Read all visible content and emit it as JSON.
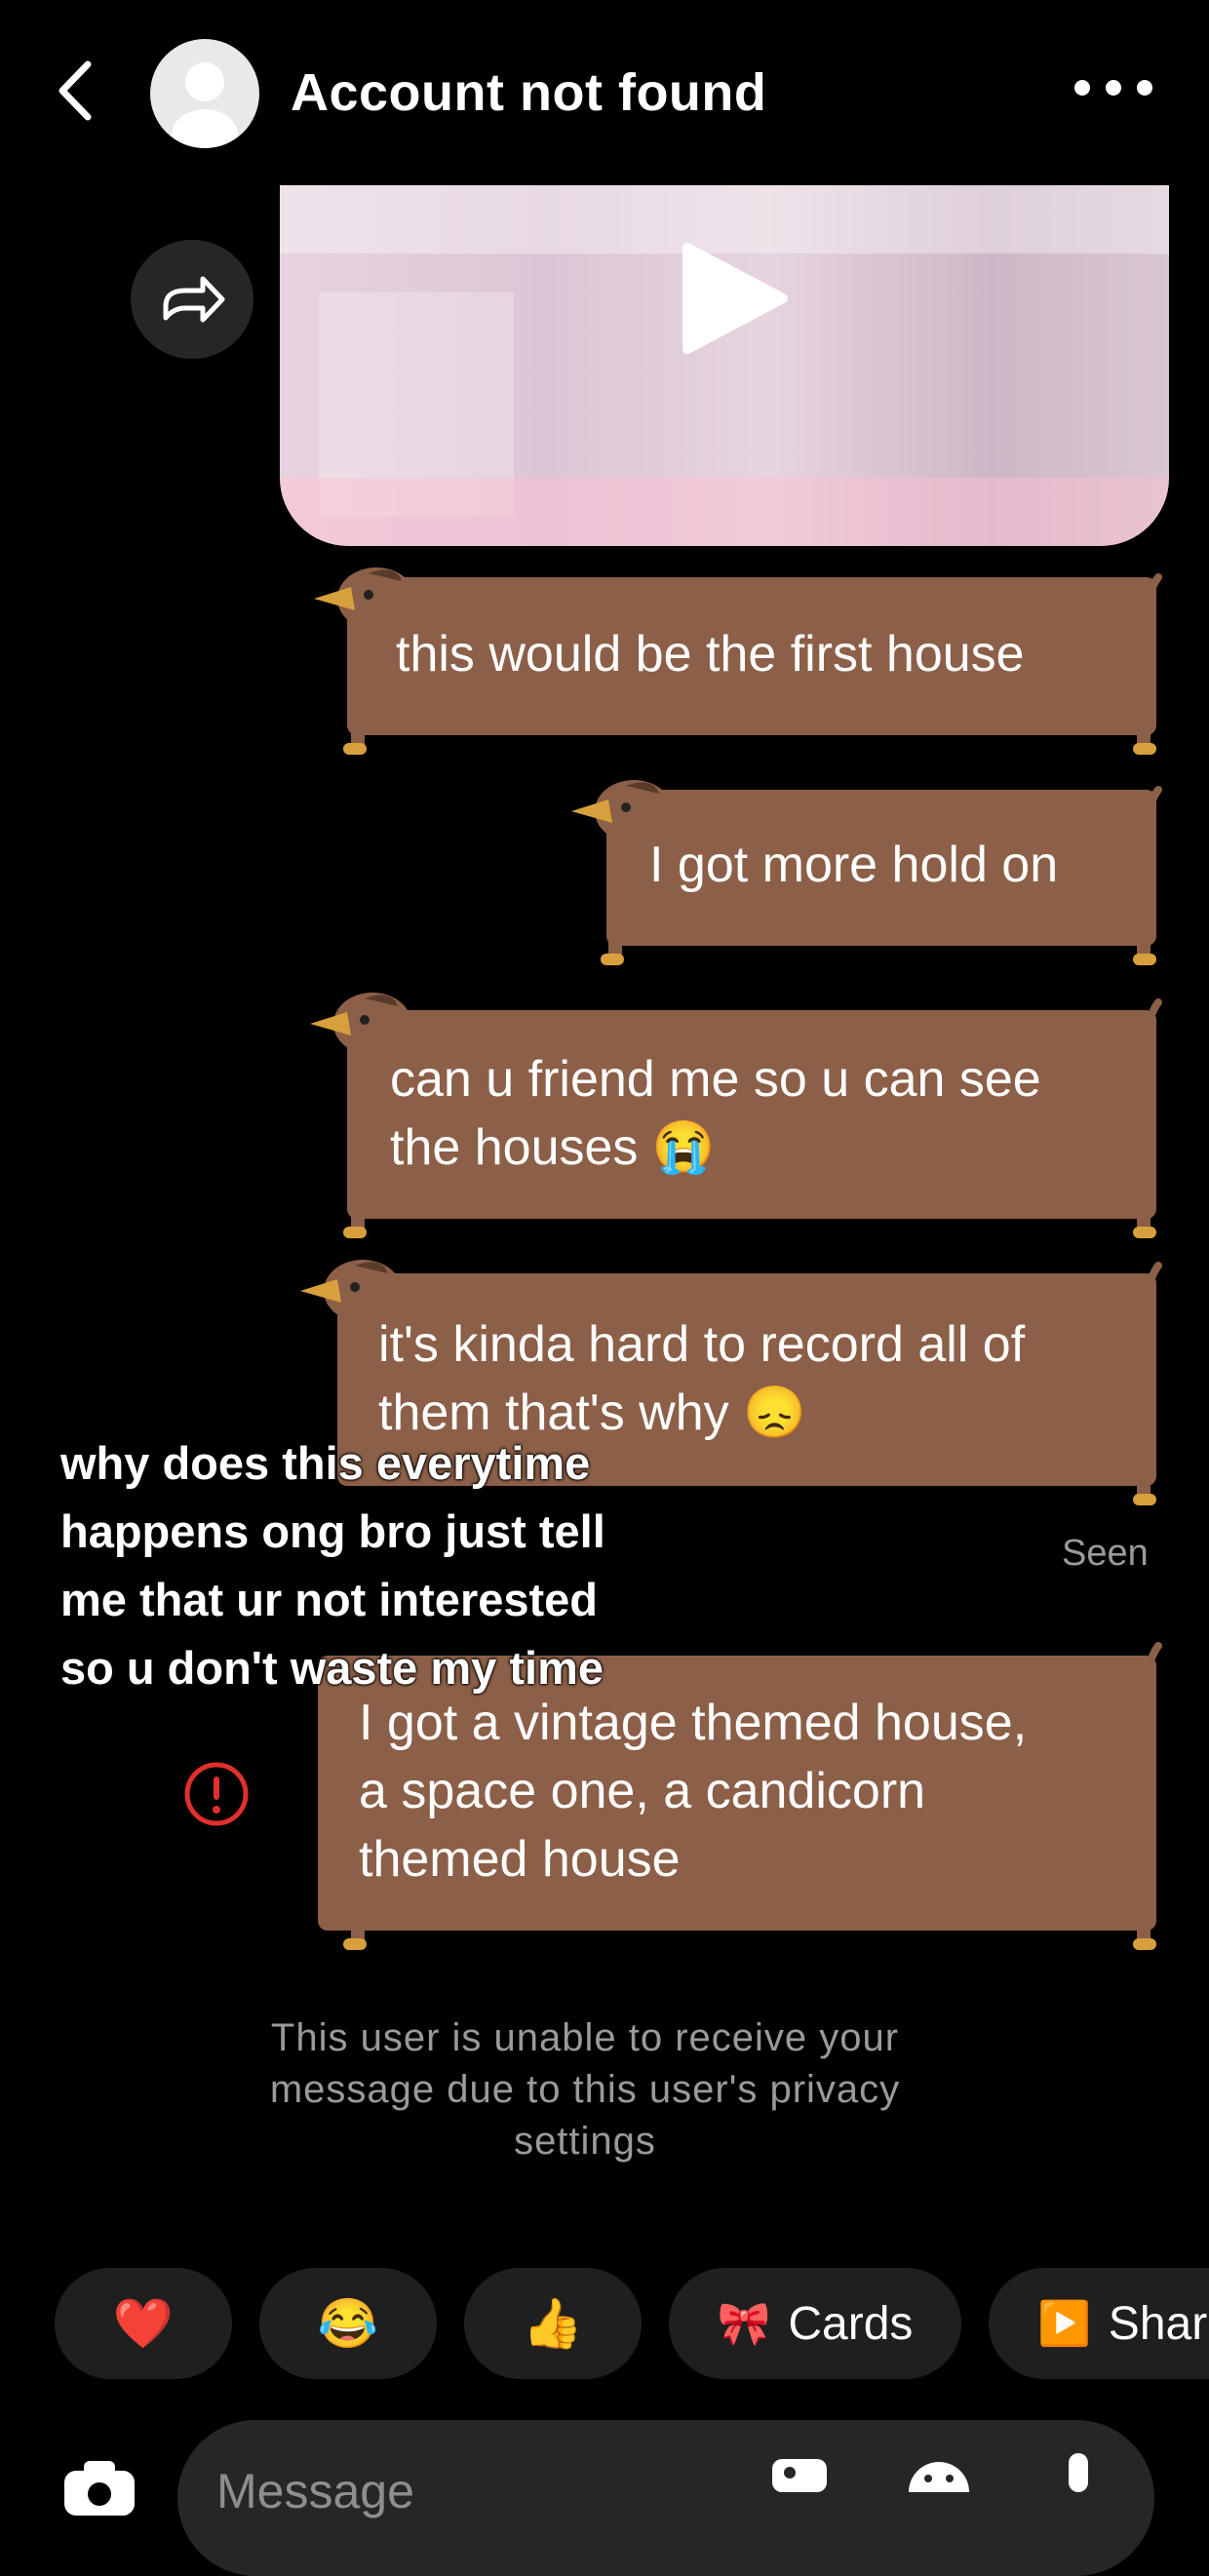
{
  "header": {
    "title": "Account not found"
  },
  "messages": [
    {
      "text": "this would be the first house"
    },
    {
      "text": "I got more hold on"
    },
    {
      "text": "can u friend me so u can see\nthe houses 😭"
    },
    {
      "text": "it's kinda hard to record all of\nthem that's why 😞"
    },
    {
      "text": "I got a vintage themed house,\na space one, a candicorn\nthemed house"
    }
  ],
  "status": {
    "seen": "Seen"
  },
  "overlay": {
    "text": "why does this everytime happens ong bro just tell me that ur not interested so u don't waste my time"
  },
  "privacy_notice": "This user is unable to receive your message due to this user's privacy settings",
  "quick_replies": [
    {
      "emoji": "❤️"
    },
    {
      "emoji": "😂"
    },
    {
      "emoji": "👍"
    },
    {
      "emoji": "🎀",
      "label": "Cards"
    },
    {
      "emoji": "▶️",
      "label": "Shar"
    }
  ],
  "composer": {
    "placeholder": "Message"
  },
  "colors": {
    "bubble": "#8c5f48",
    "background": "#000000",
    "error": "#e0302c"
  }
}
